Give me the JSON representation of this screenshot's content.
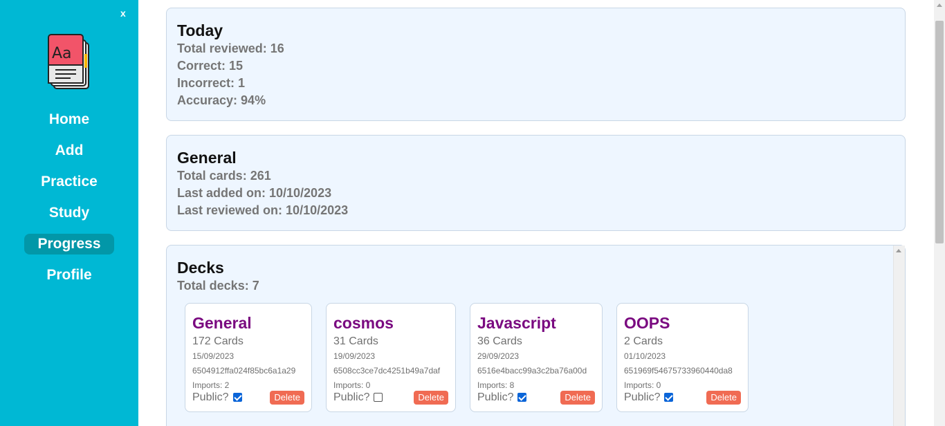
{
  "sidebar": {
    "close_label": "x",
    "logo_icon": "book-aa-icon",
    "items": [
      {
        "label": "Home",
        "active": false
      },
      {
        "label": "Add",
        "active": false
      },
      {
        "label": "Practice",
        "active": false
      },
      {
        "label": "Study",
        "active": false
      },
      {
        "label": "Progress",
        "active": true
      },
      {
        "label": "Profile",
        "active": false
      }
    ]
  },
  "today": {
    "title": "Today",
    "total_reviewed": "Total reviewed: 16",
    "correct": "Correct: 15",
    "incorrect": "Incorrect: 1",
    "accuracy": "Accuracy: 94%"
  },
  "general": {
    "title": "General",
    "total_cards": "Total cards: 261",
    "last_added": "Last added on: 10/10/2023",
    "last_reviewed": "Last reviewed on: 10/10/2023"
  },
  "decks": {
    "title": "Decks",
    "total": "Total decks: 7",
    "public_label": "Public?",
    "delete_label": "Delete",
    "items": [
      {
        "name": "General",
        "count": "172 Cards",
        "date": "15/09/2023",
        "id": "6504912ffa024f85bc6a1a29",
        "imports": "Imports: 2",
        "public": true
      },
      {
        "name": "cosmos",
        "count": "31 Cards",
        "date": "19/09/2023",
        "id": "6508cc3ce7dc4251b49a7daf",
        "imports": "Imports: 0",
        "public": false
      },
      {
        "name": "Javascript",
        "count": "36 Cards",
        "date": "29/09/2023",
        "id": "6516e4bacc99a3c2ba76a00d",
        "imports": "Imports: 8",
        "public": true
      },
      {
        "name": "OOPS",
        "count": "2 Cards",
        "date": "01/10/2023",
        "id": "651969f54675733960440da8",
        "imports": "Imports: 0",
        "public": true
      }
    ]
  },
  "colors": {
    "sidebar": "#00b8d4",
    "active_nav": "#0297a8",
    "deck_title": "#7a0a80",
    "delete_button": "#f06b53",
    "card_bg": "#eef6ff"
  }
}
